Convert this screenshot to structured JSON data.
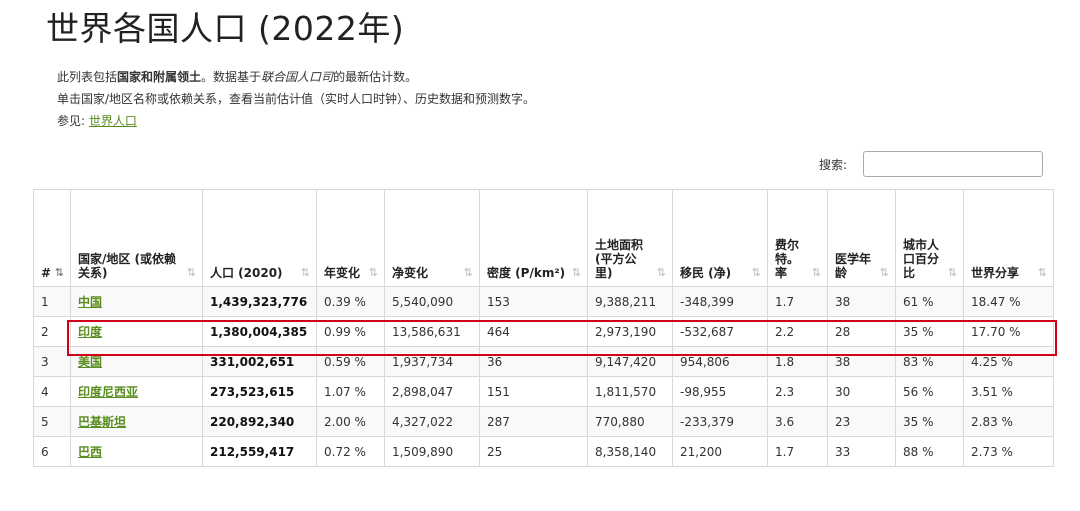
{
  "title": "世界各国人口 (2022年)",
  "intro": {
    "line1_a": "此列表包括",
    "line1_b": "国家和附属领土",
    "line1_c": "。数据基于",
    "line1_d": "联合国人口司",
    "line1_e": "的最新估计数。",
    "line2": "单击国家/地区名称或依赖关系，查看当前估计值（实时人口时钟）、历史数据和预测数字。",
    "line3_label": "参见: ",
    "line3_link": "世界人口"
  },
  "search": {
    "label": "搜索:",
    "value": ""
  },
  "columns": [
    {
      "label": "#",
      "sort": "⇅"
    },
    {
      "label": "国家/地区 (或依赖关系)",
      "sort": "⇅"
    },
    {
      "label": "人口 (2020)",
      "sort": "⇅"
    },
    {
      "label": "年变化",
      "sort": "⇅"
    },
    {
      "label": "净变化",
      "sort": "⇅"
    },
    {
      "label": "密度 (P/km²)",
      "sort": "⇅"
    },
    {
      "label": "土地面积 (平方公里)",
      "sort": "⇅"
    },
    {
      "label": "移民 (净)",
      "sort": "⇅"
    },
    {
      "label": "费尔特。率",
      "sort": "⇅"
    },
    {
      "label": "医学年龄",
      "sort": "⇅"
    },
    {
      "label": "城市人口百分比",
      "sort": "⇅"
    },
    {
      "label": "世界分享",
      "sort": "⇅"
    }
  ],
  "rows": [
    [
      "1",
      "中国",
      "1,439,323,776",
      "0.39 %",
      "5,540,090",
      "153",
      "9,388,211",
      "-348,399",
      "1.7",
      "38",
      "61 %",
      "18.47 %"
    ],
    [
      "2",
      "印度",
      "1,380,004,385",
      "0.99 %",
      "13,586,631",
      "464",
      "2,973,190",
      "-532,687",
      "2.2",
      "28",
      "35 %",
      "17.70 %"
    ],
    [
      "3",
      "美国",
      "331,002,651",
      "0.59 %",
      "1,937,734",
      "36",
      "9,147,420",
      "954,806",
      "1.8",
      "38",
      "83 %",
      "4.25 %"
    ],
    [
      "4",
      "印度尼西亚",
      "273,523,615",
      "1.07 %",
      "2,898,047",
      "151",
      "1,811,570",
      "-98,955",
      "2.3",
      "30",
      "56 %",
      "3.51 %"
    ],
    [
      "5",
      "巴基斯坦",
      "220,892,340",
      "2.00 %",
      "4,327,022",
      "287",
      "770,880",
      "-233,379",
      "3.6",
      "23",
      "35 %",
      "2.83 %"
    ],
    [
      "6",
      "巴西",
      "212,559,417",
      "0.72 %",
      "1,509,890",
      "25",
      "8,358,140",
      "21,200",
      "1.7",
      "33",
      "88 %",
      "2.73 %"
    ]
  ],
  "colors": {
    "link": "#5a8d20",
    "highlight": "#d0021b"
  }
}
